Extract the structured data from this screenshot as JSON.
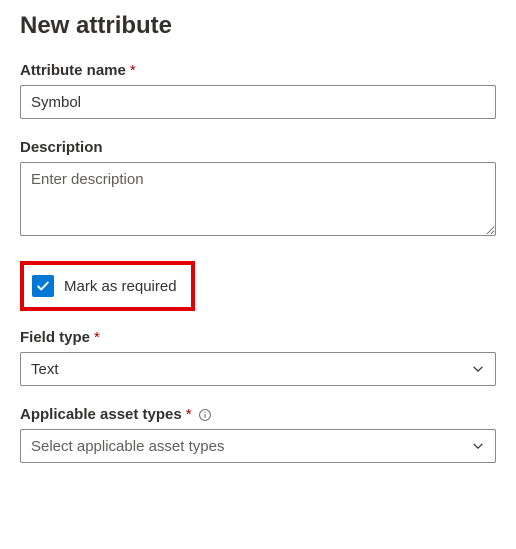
{
  "title": "New attribute",
  "fields": {
    "attributeName": {
      "label": "Attribute name",
      "required": "*",
      "value": "Symbol"
    },
    "description": {
      "label": "Description",
      "placeholder": "Enter description",
      "value": ""
    },
    "markRequired": {
      "label": "Mark as required",
      "checked": true
    },
    "fieldType": {
      "label": "Field type",
      "required": "*",
      "value": "Text"
    },
    "applicableAssetTypes": {
      "label": "Applicable asset types",
      "required": "*",
      "placeholder": "Select applicable asset types"
    }
  }
}
